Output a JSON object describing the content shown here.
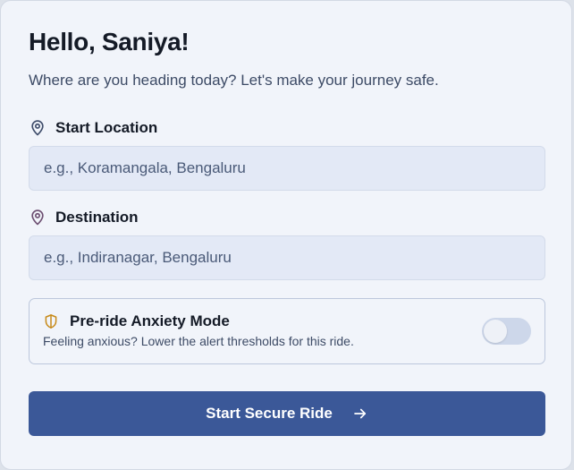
{
  "header": {
    "greeting": "Hello, Saniya!",
    "subtitle": "Where are you heading today? Let's make your journey safe."
  },
  "start_location": {
    "label": "Start Location",
    "placeholder": "e.g., Koramangala, Bengaluru",
    "value": "",
    "icon": "map-pin-icon",
    "icon_color": "#3f4d6b"
  },
  "destination": {
    "label": "Destination",
    "placeholder": "e.g., Indiranagar, Bengaluru",
    "value": "",
    "icon": "map-pin-icon",
    "icon_color": "#6d4f72"
  },
  "anxiety_mode": {
    "title": "Pre-ride Anxiety Mode",
    "description": "Feeling anxious? Lower the alert thresholds for this ride.",
    "icon": "shield-icon",
    "icon_color": "#c78a1a",
    "enabled": false
  },
  "action": {
    "label": "Start Secure Ride",
    "icon": "arrow-right-icon"
  },
  "colors": {
    "primary": "#3b5898",
    "background": "#f1f4fa",
    "input_background": "#e3e9f6"
  }
}
